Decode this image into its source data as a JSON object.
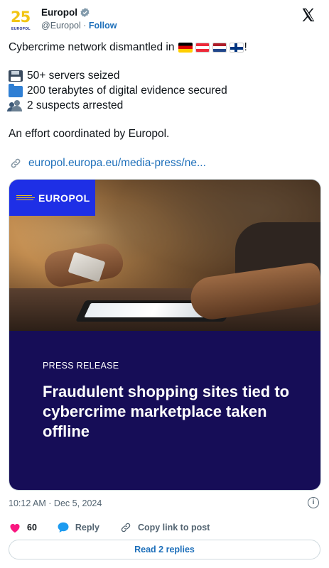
{
  "account": {
    "name": "Europol",
    "handle": "@Europol",
    "follow_label": "Follow",
    "avatar_text": "25",
    "avatar_subtext": "EUROPOL"
  },
  "post": {
    "line1": "Cybercrime network dismantled in",
    "line1_end": "!",
    "bullets": [
      {
        "icon": "floppy-disk-icon",
        "text": "50+ servers seized"
      },
      {
        "icon": "folder-icon",
        "text": "200 terabytes of digital evidence secured"
      },
      {
        "icon": "people-icon",
        "text": "2 suspects arrested"
      }
    ],
    "coordination": "An effort coordinated by Europol.",
    "link_text": "europol.europa.eu/media-press/ne..."
  },
  "card": {
    "logo_text": "EUROPOL",
    "label": "PRESS RELEASE",
    "headline": "Fraudulent shopping sites tied to cybercrime marketplace taken offline"
  },
  "meta": {
    "timestamp": "10:12 AM · Dec 5, 2024"
  },
  "actions": {
    "likes": "60",
    "reply_label": "Reply",
    "copy_label": "Copy link to post"
  },
  "replies_label": "Read 2 replies",
  "colors": {
    "link": "#1d6fba",
    "card_navy": "#160d57",
    "logo_blue": "#1e2fe6",
    "like_pink": "#f91880"
  }
}
